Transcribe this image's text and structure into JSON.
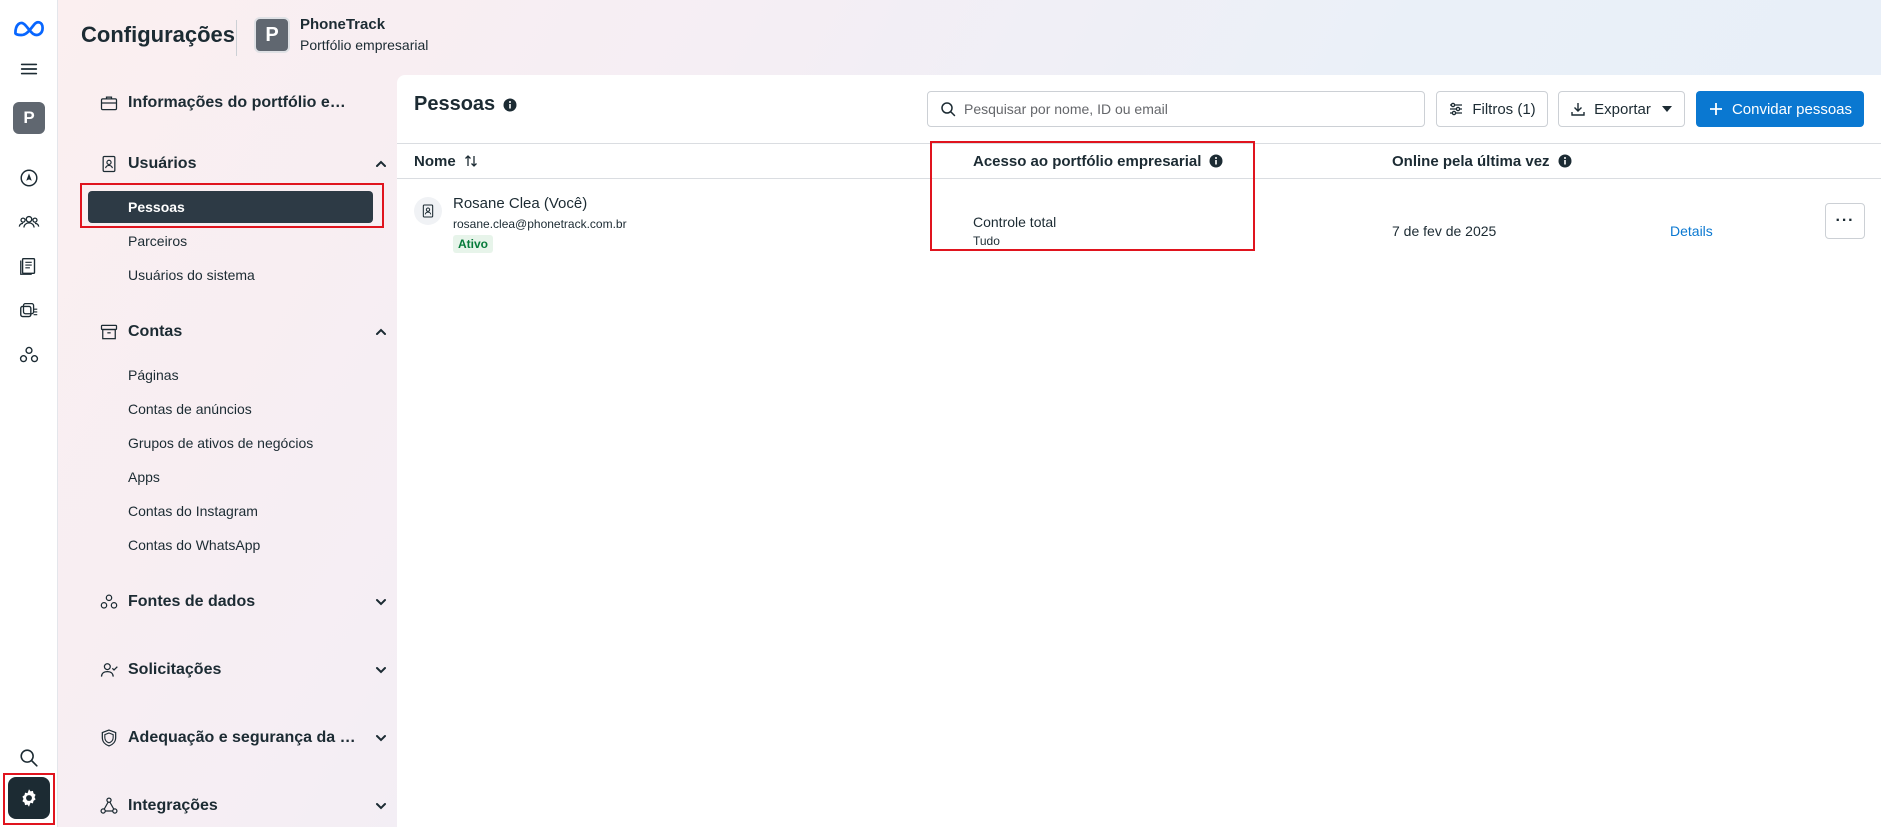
{
  "header": {
    "title": "Configurações",
    "business_initial": "P",
    "business_name": "PhoneTrack",
    "business_type": "Portfólio empresarial"
  },
  "rail": {
    "avatar_initial": "P",
    "icons": [
      "meta-logo-icon",
      "menu-icon",
      "compass-icon",
      "people-icon",
      "pages-icon",
      "ads-stack-icon",
      "network-icon",
      "search-icon",
      "gear-icon"
    ]
  },
  "sidebar": {
    "business_info": "Informações do portfólio empresarial",
    "users": {
      "label": "Usuários",
      "items": [
        "Pessoas",
        "Parceiros",
        "Usuários do sistema"
      ]
    },
    "accounts": {
      "label": "Contas",
      "items": [
        "Páginas",
        "Contas de anúncios",
        "Grupos de ativos de negócios",
        "Apps",
        "Contas do Instagram",
        "Contas do WhatsApp"
      ]
    },
    "data_sources": "Fontes de dados",
    "requests": "Solicitações",
    "security": "Adequação e segurança da marca",
    "integrations": "Integrações"
  },
  "main": {
    "title": "Pessoas",
    "search_placeholder": "Pesquisar por nome, ID ou email",
    "filters_label": "Filtros (1)",
    "export_label": "Exportar",
    "invite_label": "Convidar pessoas",
    "columns": {
      "name": "Nome",
      "access": "Acesso ao portfólio empresarial",
      "online": "Online pela última vez"
    },
    "rows": [
      {
        "name": "Rosane Clea (Você)",
        "email": "rosane.clea@phonetrack.com.br",
        "status": "Ativo",
        "access": "Controle total",
        "access_detail": "Tudo",
        "last_online": "7 de fev de 2025",
        "details": "Details",
        "more": "···"
      }
    ]
  },
  "colors": {
    "primary": "#0a78d1",
    "active_nav": "#2d3a45",
    "highlight": "#e0141e",
    "status_green": "#067b3a"
  }
}
